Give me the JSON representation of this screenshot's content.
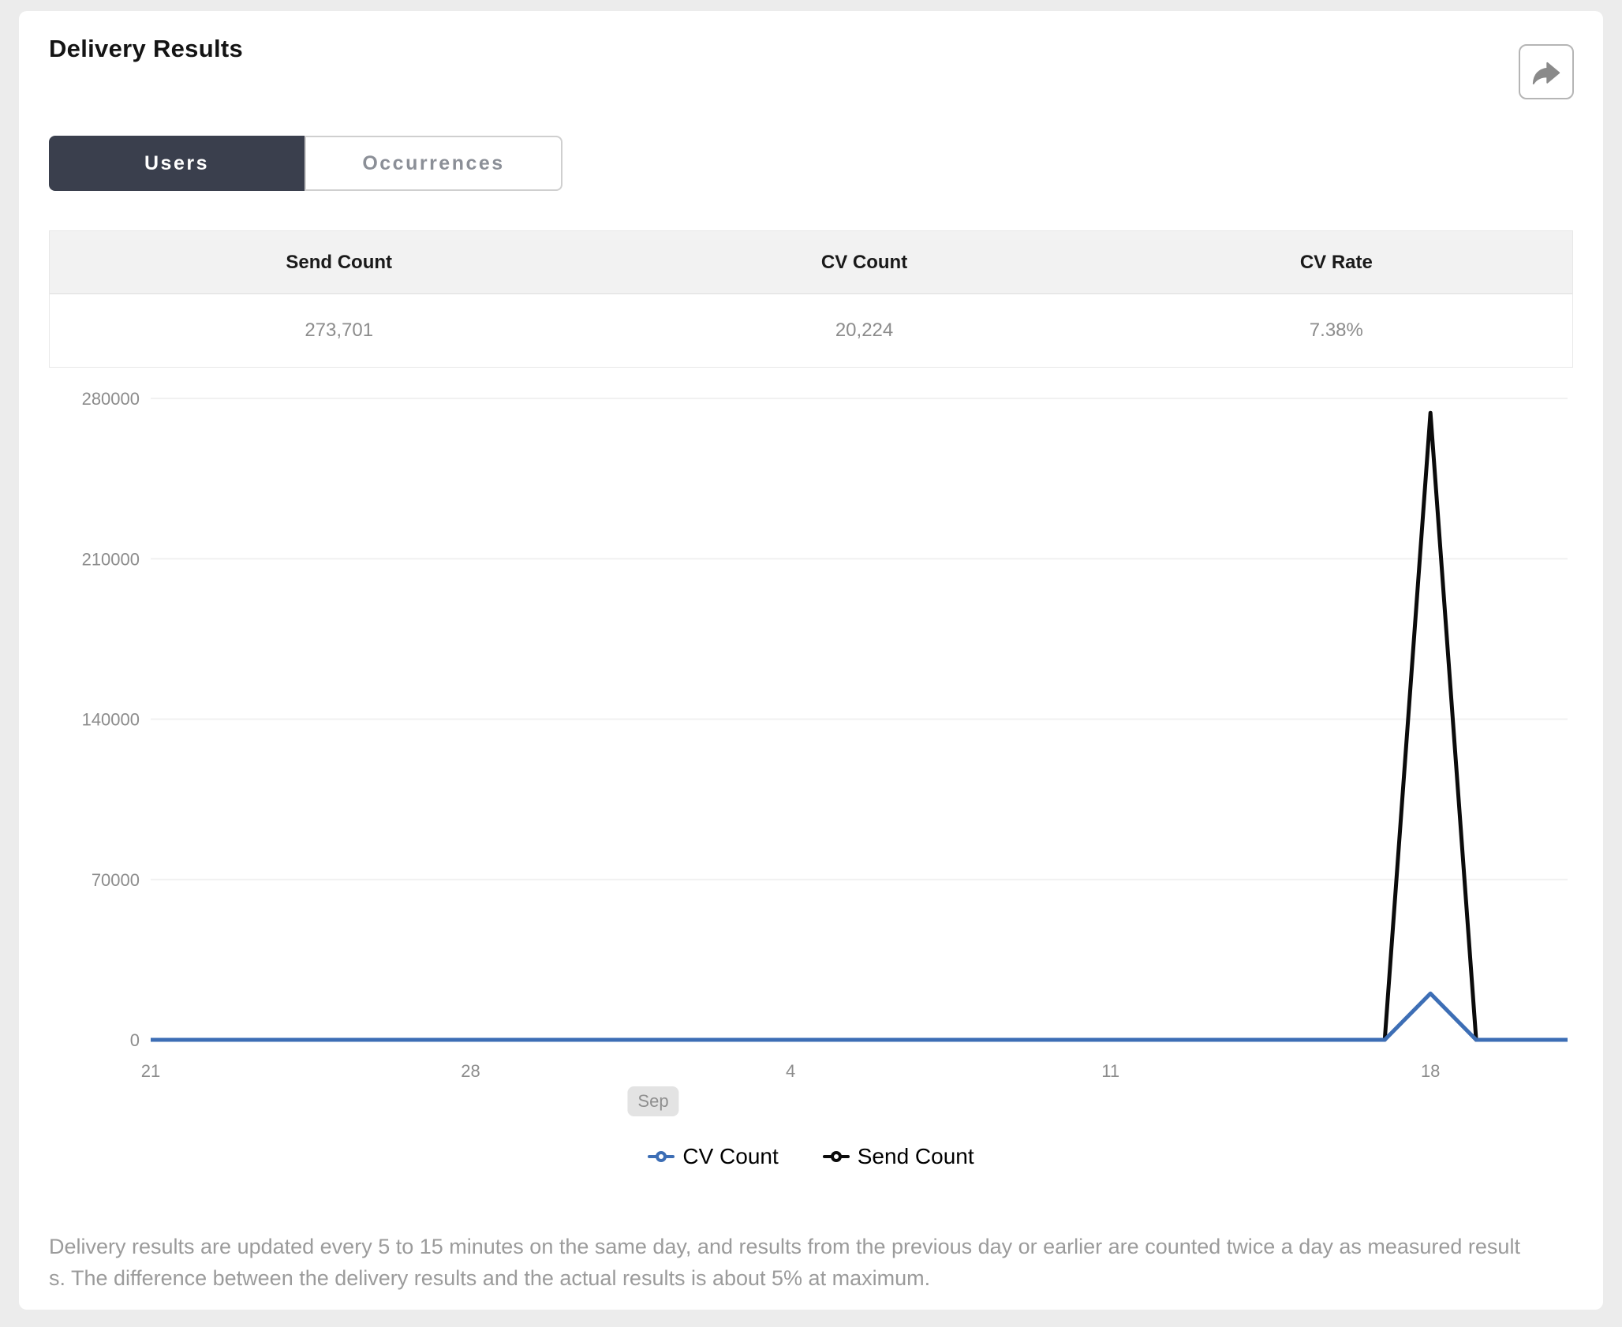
{
  "header": {
    "title": "Delivery Results",
    "share_icon": "share-forward-arrow"
  },
  "tabs": [
    {
      "label": "Users",
      "active": true
    },
    {
      "label": "Occurrences",
      "active": false
    }
  ],
  "summary_table": {
    "columns": [
      "Send Count",
      "CV Count",
      "CV Rate"
    ],
    "values": [
      "273,701",
      "20,224",
      "7.38%"
    ]
  },
  "chart_data": {
    "type": "line",
    "title": "",
    "xlabel": "",
    "ylabel": "",
    "ylim": [
      0,
      280000
    ],
    "y_ticks": [
      0,
      70000,
      140000,
      210000,
      280000
    ],
    "grid": true,
    "legend_position": "bottom",
    "x_ticks": [
      {
        "index": 0,
        "label": "21"
      },
      {
        "index": 7,
        "label": "28"
      },
      {
        "index": 14,
        "label": "4"
      },
      {
        "index": 21,
        "label": "11"
      },
      {
        "index": 28,
        "label": "18"
      }
    ],
    "month_marker": {
      "index": 11,
      "label": "Sep"
    },
    "series": [
      {
        "name": "CV Count",
        "color": "#3d6eb5",
        "values": [
          0,
          0,
          0,
          0,
          0,
          0,
          0,
          0,
          0,
          0,
          0,
          0,
          0,
          0,
          0,
          0,
          0,
          0,
          0,
          0,
          0,
          0,
          0,
          0,
          0,
          0,
          0,
          0,
          20224,
          0,
          0,
          0
        ]
      },
      {
        "name": "Send Count",
        "color": "#0b0b0b",
        "values": [
          0,
          0,
          0,
          0,
          0,
          0,
          0,
          0,
          0,
          0,
          0,
          0,
          0,
          0,
          0,
          0,
          0,
          0,
          0,
          0,
          0,
          0,
          0,
          0,
          0,
          0,
          0,
          0,
          273701,
          0,
          0,
          0
        ]
      }
    ]
  },
  "axis_style": {
    "label_color": "#8c8c8c",
    "grid_color": "#f1f1f1"
  },
  "footnote": {
    "lines": [
      "Delivery results are updated every 5 to 15 minutes on the same day, and results from the previous day or earlier are counted twice a day as measured result",
      "s. The difference between the delivery results and the actual results is about 5% at maximum."
    ]
  }
}
